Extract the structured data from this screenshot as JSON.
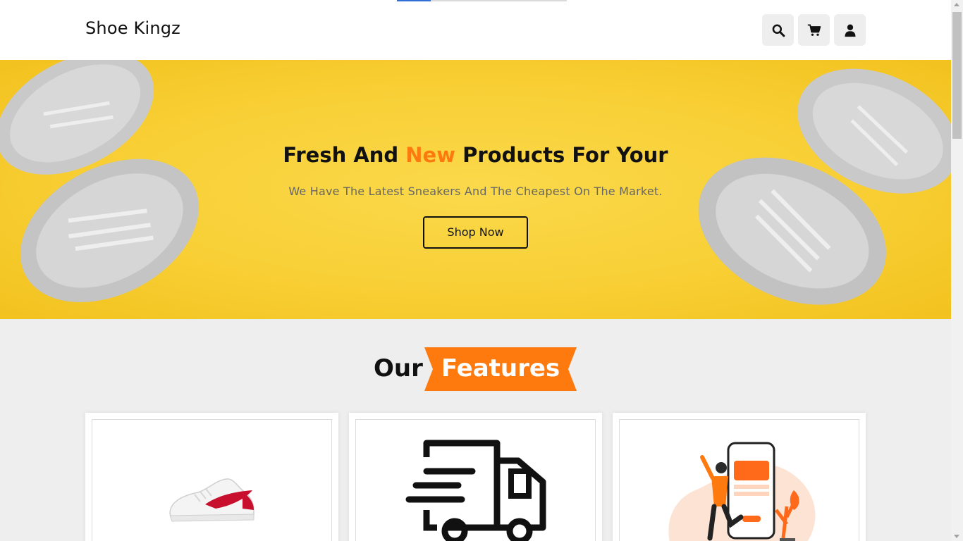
{
  "brand": {
    "name": "Shoe Kingz"
  },
  "header": {
    "buttons": [
      {
        "icon": "search-icon"
      },
      {
        "icon": "cart-icon"
      },
      {
        "icon": "user-icon"
      }
    ]
  },
  "loading": {
    "progress": 0.2
  },
  "hero": {
    "title_before": "Fresh And ",
    "title_accent": "New",
    "title_after": " Products For Your",
    "subtitle": "We Have The Latest Sneakers And The Cheapest On The Market.",
    "cta_label": "Shop Now"
  },
  "features": {
    "heading_plain": "Our",
    "heading_ribbon": "Features",
    "cards": [
      {
        "image": "sneaker-image"
      },
      {
        "image": "delivery-truck-icon"
      },
      {
        "image": "mobile-payment-illustration"
      }
    ]
  },
  "colors": {
    "accent": "#ff7a0e",
    "hero_bg": "#f8cf35",
    "page_bg": "#eeeeee"
  }
}
